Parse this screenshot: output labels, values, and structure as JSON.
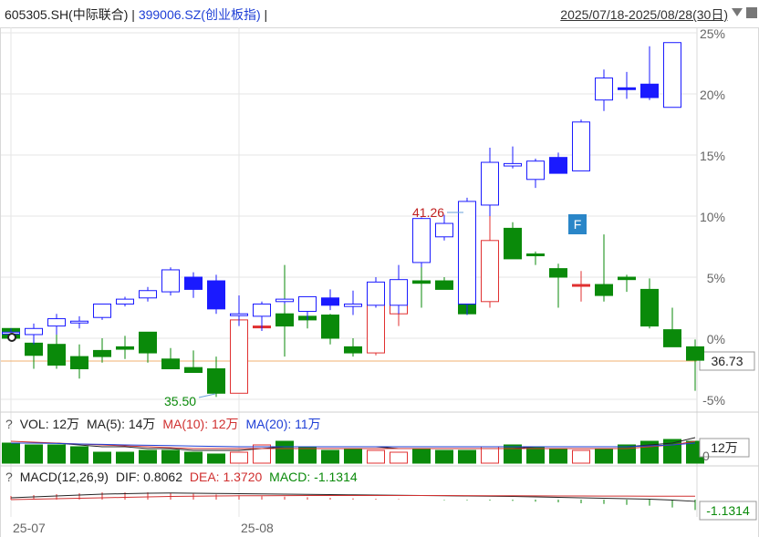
{
  "header": {
    "stock": "605305.SH(中际联合)",
    "separator": "|",
    "compare": "399006.SZ(创业板指)",
    "range": "2025/07/18-2025/08/28(30日)"
  },
  "colors": {
    "up": "#e03030",
    "down": "#0a8a0a",
    "blue": "#1a1aff",
    "grid": "#e6e6e6",
    "ref": "#f0b070"
  },
  "icons": [
    "dropdown-icon",
    "close-icon",
    "help-icon",
    "flag-f-icon"
  ],
  "main_axis_labels": [
    "25%",
    "20%",
    "15%",
    "10%",
    "5%",
    "0%",
    "-5%"
  ],
  "price_tag": "36.73",
  "annotations": {
    "high": "41.26",
    "low": "35.50",
    "flag": "F"
  },
  "vol_legend": {
    "q": "?",
    "vol": "VOL: 12万",
    "ma5": "MA(5): 14万",
    "ma10": "MA(10): 12万",
    "ma20": "MA(20): 11万",
    "tag": "12万"
  },
  "macd_legend": {
    "q": "?",
    "macd": "MACD(12,26,9)",
    "dif": "DIF: 0.8062",
    "dea": "DEA: 1.3720",
    "hist": "MACD: -1.1314",
    "tag": "-1.1314"
  },
  "x_labels": [
    "25-07",
    "25-08"
  ],
  "chart_data": {
    "type": "candlestick",
    "y_unit": "%",
    "ylim": [
      -5,
      25
    ],
    "series": [
      {
        "name": "605305.SH",
        "style": "filled",
        "ohlc": [
          [
            0.8,
            0.8,
            -0.2,
            0.0
          ],
          [
            -0.4,
            0.6,
            -2.5,
            -1.4
          ],
          [
            -0.5,
            0.5,
            -2.5,
            -2.2
          ],
          [
            -1.5,
            -0.5,
            -3.3,
            -2.5
          ],
          [
            -1.0,
            0.0,
            -2.0,
            -1.5
          ],
          [
            -0.7,
            0.2,
            -1.7,
            -0.9
          ],
          [
            0.5,
            0.5,
            -2.0,
            -1.2
          ],
          [
            -1.7,
            -0.8,
            -2.5,
            -2.5
          ],
          [
            -2.4,
            -1.0,
            -2.8,
            -2.8
          ],
          [
            -2.5,
            -1.5,
            -4.8,
            -4.5
          ],
          [
            -4.5,
            3.5,
            -4.5,
            1.5
          ],
          [
            1.0,
            1.0,
            1.0,
            1.0
          ],
          [
            2.0,
            6.0,
            -1.5,
            1.0
          ],
          [
            1.8,
            3.0,
            0.8,
            1.5
          ],
          [
            1.9,
            2.0,
            -0.5,
            0.0
          ],
          [
            -0.7,
            0.0,
            -1.5,
            -1.2
          ],
          [
            -1.2,
            3.6,
            -1.4,
            2.8
          ],
          [
            2.0,
            4.8,
            1.0,
            4.5
          ],
          [
            4.7,
            6.7,
            2.5,
            4.5
          ],
          [
            4.7,
            5.0,
            4.0,
            4.0
          ],
          [
            4.5,
            4.8,
            2.0,
            2.0
          ],
          [
            3.0,
            10.0,
            2.5,
            8.0
          ],
          [
            9.0,
            9.5,
            6.5,
            6.5
          ],
          [
            6.9,
            7.1,
            6.0,
            6.8
          ],
          [
            5.7,
            6.1,
            2.5,
            5.0
          ],
          [
            4.4,
            5.5,
            3.0,
            4.4
          ],
          [
            4.4,
            8.5,
            3.0,
            3.5
          ],
          [
            5.0,
            5.2,
            3.8,
            4.8
          ],
          [
            4.0,
            4.9,
            0.8,
            1.0
          ],
          [
            0.7,
            2.5,
            -0.7,
            -0.7
          ],
          [
            -0.7,
            -0.1,
            -4.3,
            -1.8
          ]
        ]
      },
      {
        "name": "399006.SZ",
        "style": "hollow",
        "ohlc": [
          [
            0.5,
            0.8,
            -0.2,
            0.5
          ],
          [
            0.3,
            1.2,
            -0.5,
            0.8
          ],
          [
            1.0,
            2.0,
            0.3,
            1.6
          ],
          [
            1.3,
            1.8,
            0.8,
            1.4
          ],
          [
            1.7,
            2.8,
            1.5,
            2.8
          ],
          [
            2.8,
            3.4,
            2.6,
            3.2
          ],
          [
            3.3,
            4.2,
            3.0,
            3.9
          ],
          [
            3.8,
            5.8,
            3.5,
            5.6
          ],
          [
            5.0,
            5.4,
            3.3,
            4.0
          ],
          [
            4.7,
            5.2,
            2.0,
            2.4
          ],
          [
            2.0,
            3.5,
            1.0,
            2.0
          ],
          [
            1.8,
            3.0,
            0.6,
            2.8
          ],
          [
            3.0,
            3.2,
            2.8,
            3.2
          ],
          [
            2.2,
            3.4,
            1.5,
            3.4
          ],
          [
            3.3,
            4.0,
            2.3,
            2.7
          ],
          [
            2.6,
            3.9,
            1.9,
            2.8
          ],
          [
            2.7,
            5.0,
            2.5,
            4.6
          ],
          [
            2.7,
            6.0,
            2.0,
            4.8
          ],
          [
            6.2,
            9.9,
            5.8,
            9.8
          ],
          [
            8.3,
            10.1,
            8.0,
            9.4
          ],
          [
            2.8,
            11.5,
            1.9,
            11.2
          ],
          [
            10.9,
            15.6,
            10.0,
            14.4
          ],
          [
            14.1,
            15.7,
            13.9,
            14.3
          ],
          [
            13.0,
            14.7,
            12.3,
            14.5
          ],
          [
            14.8,
            15.2,
            13.5,
            13.5
          ],
          [
            13.7,
            17.9,
            13.7,
            17.7
          ],
          [
            19.5,
            22.0,
            18.6,
            21.3
          ],
          [
            20.5,
            21.8,
            19.6,
            20.4
          ],
          [
            20.8,
            23.9,
            19.5,
            19.7
          ],
          [
            18.9,
            24.2,
            18.9,
            24.2
          ]
        ]
      }
    ],
    "volume_wan": [
      11,
      10,
      10,
      9,
      6,
      6,
      7,
      7,
      6,
      5,
      6,
      10,
      12,
      9,
      7,
      8,
      7,
      6,
      8,
      7,
      7,
      9,
      10,
      9,
      8,
      7,
      8,
      10,
      12,
      13,
      12
    ],
    "volume_ma": [
      {
        "name": "MA(5)",
        "values": [
          11,
          11,
          11,
          10,
          9,
          9,
          8,
          8,
          7,
          7,
          7,
          8,
          9,
          9,
          9,
          9,
          9,
          8,
          8,
          8,
          8,
          8,
          8,
          9,
          9,
          9,
          9,
          9,
          10,
          11,
          14
        ]
      },
      {
        "name": "MA(10)",
        "values": [
          12,
          11.5,
          11,
          10.5,
          10,
          9.5,
          9,
          8.5,
          8,
          8,
          8,
          8,
          8,
          8,
          8,
          8,
          8,
          8,
          8,
          8,
          8,
          8,
          8,
          8,
          8,
          8,
          8,
          8,
          9,
          10,
          12
        ]
      },
      {
        "name": "MA(20)",
        "values": [
          11,
          11,
          10.8,
          10.5,
          10.3,
          10,
          9.8,
          9.6,
          9.4,
          9.2,
          9,
          9,
          9,
          9,
          9,
          9,
          9,
          9,
          9,
          9,
          9,
          9,
          9,
          9,
          9,
          9,
          9,
          9,
          9.5,
          10,
          11
        ]
      }
    ],
    "macd": {
      "dif": [
        1.2,
        1.3,
        1.4,
        1.5,
        1.6,
        1.65,
        1.7,
        1.72,
        1.7,
        1.68,
        1.65,
        1.62,
        1.6,
        1.58,
        1.55,
        1.52,
        1.5,
        1.48,
        1.45,
        1.42,
        1.4,
        1.38,
        1.35,
        1.3,
        1.25,
        1.2,
        1.15,
        1.1,
        1.05,
        0.95,
        0.8062
      ],
      "dea": [
        1.0,
        1.05,
        1.1,
        1.15,
        1.2,
        1.25,
        1.3,
        1.35,
        1.38,
        1.4,
        1.42,
        1.43,
        1.44,
        1.45,
        1.45,
        1.45,
        1.45,
        1.45,
        1.45,
        1.45,
        1.44,
        1.43,
        1.42,
        1.41,
        1.4,
        1.4,
        1.39,
        1.39,
        1.38,
        1.38,
        1.372
      ],
      "hist": [
        0.4,
        0.5,
        0.6,
        0.7,
        0.8,
        0.8,
        0.8,
        0.74,
        0.64,
        0.56,
        0.46,
        0.38,
        0.32,
        0.26,
        0.2,
        0.14,
        0.1,
        0.06,
        0.0,
        -0.06,
        -0.08,
        -0.1,
        -0.14,
        -0.22,
        -0.3,
        -0.4,
        -0.48,
        -0.58,
        -0.66,
        -0.86,
        -1.1314
      ]
    },
    "markers": {
      "high": 41.26,
      "low": 35.5,
      "last_price": 36.73
    }
  }
}
